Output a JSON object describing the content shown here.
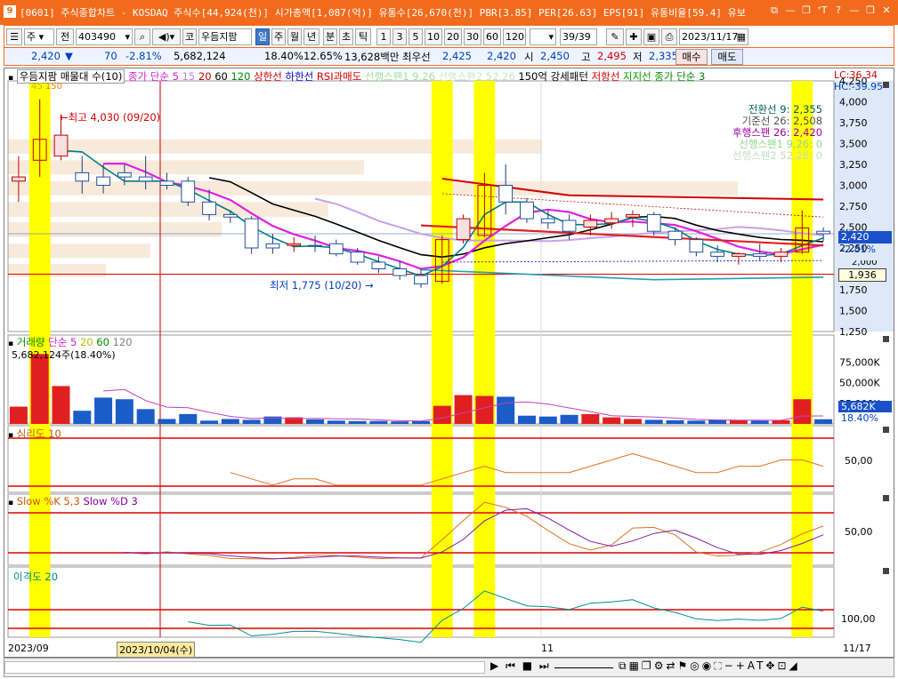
{
  "window": {
    "icon_label": "9",
    "title": "[0601] 주식종합차트 - KOSDAQ 주식수[44,924(천)] 시가총액[1,087(억)] 유통수[26,670(천)] PBR[3.85] PER[26.63] EPS[91] 유통비율[59.4] 유보",
    "controls": [
      "⧉",
      "—",
      "❐",
      "ᐩT",
      "?",
      "—",
      "❐",
      "✕"
    ]
  },
  "toolbar": {
    "market": "주",
    "all_label": "전",
    "code": "403490",
    "stock_name": "우듬지팜",
    "market_badge": "코",
    "periods": [
      "일",
      "주",
      "월",
      "년",
      "분",
      "초",
      "틱"
    ],
    "period_selected": "일",
    "intervals": [
      "1",
      "3",
      "5",
      "10",
      "20",
      "30",
      "60",
      "120"
    ],
    "page": "39",
    "page_total": "/39",
    "date": "2023/11/17",
    "buy_label": "매수",
    "sell_label": "매도"
  },
  "quote": {
    "price": "2,420",
    "arrow": "▼",
    "change": "70",
    "change_pct": "-2.81%",
    "volume": "5,682,124",
    "volume_ratio": "18.40%",
    "turnover": "12.65%",
    "amount": "13,628백만",
    "best_label": "최우선",
    "ask": "2,425",
    "bid": "2,420",
    "open_label": "시",
    "open": "2,450",
    "high_label": "고",
    "high": "2,495",
    "low_label": "저",
    "low": "2,335"
  },
  "price_panel": {
    "legend": [
      {
        "text": "우듬지팜 매물대 수(10)",
        "color": "#000000"
      },
      {
        "text": "종가 단순 5",
        "color": "#d41bd4"
      },
      {
        "text": "15",
        "color": "#c080e0"
      },
      {
        "text": "20",
        "color": "#cc0000"
      },
      {
        "text": "60",
        "color": "#000000"
      },
      {
        "text": "120",
        "color": "#008800"
      },
      {
        "text": "상한선",
        "color": "#d40000"
      },
      {
        "text": "하한선",
        "color": "#0000c0"
      },
      {
        "text": "RSI과매도",
        "color": "#d40000"
      },
      {
        "text": "선행스팬1 9,26",
        "color": "#9be09b"
      },
      {
        "text": "선행스팬2 52,26",
        "color": "#c8e8c8"
      },
      {
        "text": "150억 강세패턴",
        "color": "#000000"
      },
      {
        "text": "저항선",
        "color": "#d40000"
      },
      {
        "text": "지지선",
        "color": "#00a000"
      },
      {
        "text": "종가 단순 3",
        "color": "#008800"
      }
    ],
    "sub_legend": [
      {
        "text": "45",
        "color": "#bbbb00"
      },
      {
        "text": "150",
        "color": "#e08000"
      }
    ],
    "lc": "LC:36.34",
    "hc": "HC:-39.95",
    "ichimoku": [
      {
        "text": "전환선 9: 2,355",
        "color": "#006060"
      },
      {
        "text": "기준선 26: 2,508",
        "color": "#505050"
      },
      {
        "text": "후행스팬 26: 2,420",
        "color": "#a000a0"
      },
      {
        "text": "선행스팬1 9,26: 0",
        "color": "#90d890"
      },
      {
        "text": "선행스팬2 52,26: 0",
        "color": "#c0e0c0"
      }
    ],
    "y_ticks": [
      "4,250",
      "4,000",
      "3,750",
      "3,500",
      "3,250",
      "3,000",
      "2,750",
      "2,500",
      "2,250",
      "2,000",
      "1,750",
      "1,500",
      "1,250"
    ],
    "high_marker": "최고 4,030 (09/20)",
    "low_marker": "최저 1,775 (10/20)",
    "current_price_tag": "2,420",
    "current_pct_tag": "-2.81%",
    "ref_price_tag": "1,936",
    "min_tick_label": "2,000"
  },
  "volume_panel": {
    "legend": [
      {
        "text": "거래량",
        "color": "#008800"
      },
      {
        "text": "단순 5",
        "color": "#d41bd4"
      },
      {
        "text": "20",
        "color": "#bbbb00"
      },
      {
        "text": "60",
        "color": "#008800"
      },
      {
        "text": "120",
        "color": "#808080"
      }
    ],
    "value_label": "5,682,124주(18.40%)",
    "y_ticks": [
      "75,000K",
      "50,000K",
      "25,000K"
    ],
    "current_tag": "5,682K",
    "current_pct": "18.40%"
  },
  "psy_panel": {
    "legend": "심리도 10",
    "legend_color": "#cc5500",
    "y_tick": "50,00"
  },
  "stoch_panel": {
    "legend": [
      {
        "text": "Slow %K 5,3",
        "color": "#cc5500"
      },
      {
        "text": "Slow %D 3",
        "color": "#8000a0"
      }
    ],
    "y_tick": "50,00"
  },
  "disparity_panel": {
    "legend": "이격도 20",
    "legend_color": "#008888",
    "y_tick": "100,00"
  },
  "x_axis": {
    "labels": [
      "2023/09",
      "11",
      "11/17"
    ],
    "cursor_date": "2023/10/04(수)"
  },
  "chart_data": {
    "type": "candlestick",
    "price_unit": "KRW",
    "ylim": [
      1250,
      4250
    ],
    "candles": [
      {
        "o": 3050,
        "h": 3350,
        "l": 2800,
        "c": 3100
      },
      {
        "o": 3300,
        "h": 4030,
        "l": 3100,
        "c": 3550
      },
      {
        "o": 3350,
        "h": 3850,
        "l": 3300,
        "c": 3600
      },
      {
        "o": 3150,
        "h": 3350,
        "l": 2900,
        "c": 3050
      },
      {
        "o": 3100,
        "h": 3250,
        "l": 2900,
        "c": 3000
      },
      {
        "o": 3150,
        "h": 3250,
        "l": 3000,
        "c": 3100
      },
      {
        "o": 3100,
        "h": 3350,
        "l": 2950,
        "c": 3050
      },
      {
        "o": 3050,
        "h": 3150,
        "l": 2950,
        "c": 3000
      },
      {
        "o": 3050,
        "h": 3100,
        "l": 2750,
        "c": 2800
      },
      {
        "o": 2800,
        "h": 2950,
        "l": 2580,
        "c": 2650
      },
      {
        "o": 2650,
        "h": 2700,
        "l": 2550,
        "c": 2620
      },
      {
        "o": 2600,
        "h": 2630,
        "l": 2180,
        "c": 2250
      },
      {
        "o": 2300,
        "h": 2420,
        "l": 2180,
        "c": 2250
      },
      {
        "o": 2280,
        "h": 2380,
        "l": 2200,
        "c": 2300
      },
      {
        "o": 2280,
        "h": 2400,
        "l": 2200,
        "c": 2270
      },
      {
        "o": 2300,
        "h": 2350,
        "l": 2150,
        "c": 2180
      },
      {
        "o": 2200,
        "h": 2250,
        "l": 2050,
        "c": 2080
      },
      {
        "o": 2080,
        "h": 2150,
        "l": 1950,
        "c": 2000
      },
      {
        "o": 2000,
        "h": 2100,
        "l": 1870,
        "c": 1920
      },
      {
        "o": 1920,
        "h": 2000,
        "l": 1775,
        "c": 1820
      },
      {
        "o": 1850,
        "h": 2400,
        "l": 1820,
        "c": 2350
      },
      {
        "o": 2350,
        "h": 2650,
        "l": 2300,
        "c": 2600
      },
      {
        "o": 2400,
        "h": 3150,
        "l": 2380,
        "c": 3000
      },
      {
        "o": 3000,
        "h": 3250,
        "l": 2650,
        "c": 2800
      },
      {
        "o": 2800,
        "h": 2850,
        "l": 2550,
        "c": 2600
      },
      {
        "o": 2600,
        "h": 2700,
        "l": 2480,
        "c": 2550
      },
      {
        "o": 2580,
        "h": 2650,
        "l": 2350,
        "c": 2450
      },
      {
        "o": 2500,
        "h": 2650,
        "l": 2400,
        "c": 2580
      },
      {
        "o": 2550,
        "h": 2680,
        "l": 2480,
        "c": 2600
      },
      {
        "o": 2620,
        "h": 2700,
        "l": 2500,
        "c": 2650
      },
      {
        "o": 2650,
        "h": 2680,
        "l": 2400,
        "c": 2450
      },
      {
        "o": 2450,
        "h": 2500,
        "l": 2280,
        "c": 2350
      },
      {
        "o": 2350,
        "h": 2380,
        "l": 2150,
        "c": 2200
      },
      {
        "o": 2200,
        "h": 2280,
        "l": 2080,
        "c": 2150
      },
      {
        "o": 2150,
        "h": 2200,
        "l": 2050,
        "c": 2180
      },
      {
        "o": 2180,
        "h": 2300,
        "l": 2100,
        "c": 2150
      },
      {
        "o": 2150,
        "h": 2250,
        "l": 2080,
        "c": 2200
      },
      {
        "o": 2200,
        "h": 2700,
        "l": 2180,
        "c": 2490
      },
      {
        "o": 2450,
        "h": 2495,
        "l": 2335,
        "c": 2420
      }
    ],
    "volume_k": [
      21000,
      85000,
      46000,
      16000,
      32000,
      30000,
      18000,
      6000,
      12000,
      4000,
      6000,
      5000,
      9000,
      8000,
      5500,
      4000,
      3500,
      3500,
      3000,
      3500,
      22000,
      35000,
      34000,
      33000,
      10000,
      9000,
      11000,
      12000,
      8000,
      6000,
      5000,
      4500,
      4000,
      5000,
      4500,
      4000,
      4500,
      30000,
      5682
    ],
    "highlight_indices": [
      1,
      20,
      22,
      37
    ],
    "cursor_index": 7
  }
}
